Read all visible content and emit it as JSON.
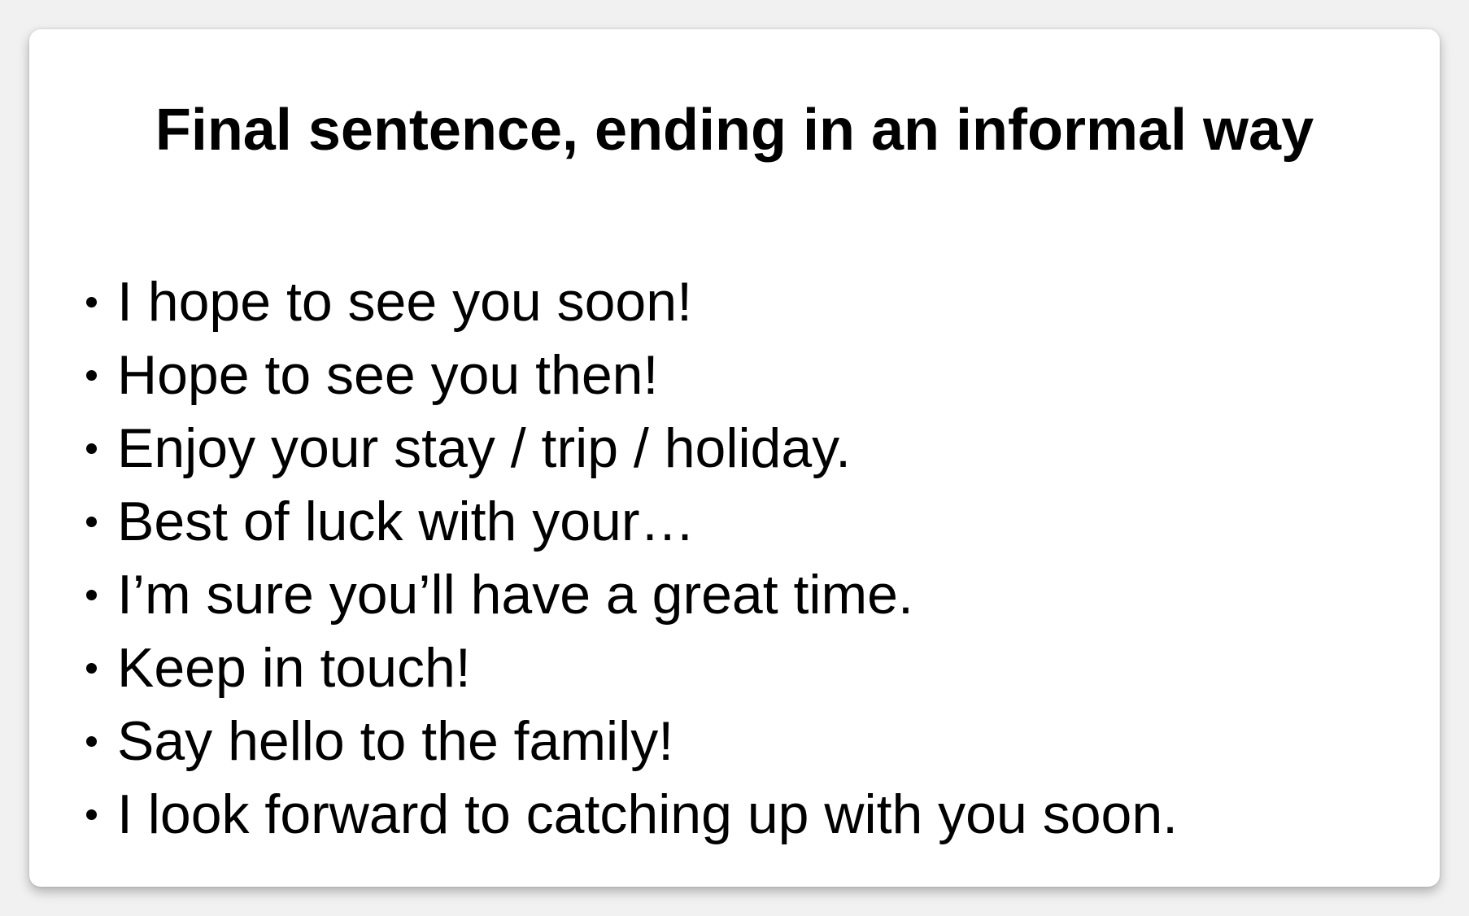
{
  "slide": {
    "title": "Final sentence, ending in an informal way",
    "items": [
      {
        "text": "I hope to see you soon!"
      },
      {
        "text": "Hope to see you then!"
      },
      {
        "text": "Enjoy your stay / trip / holiday."
      },
      {
        "text": "Best of luck with your…"
      },
      {
        "text": "I’m sure you’ll have a great time."
      },
      {
        "text": "Keep in touch!"
      },
      {
        "text": "Say hello to the family!"
      },
      {
        "text": "I look forward to catching up with you soon."
      }
    ]
  }
}
